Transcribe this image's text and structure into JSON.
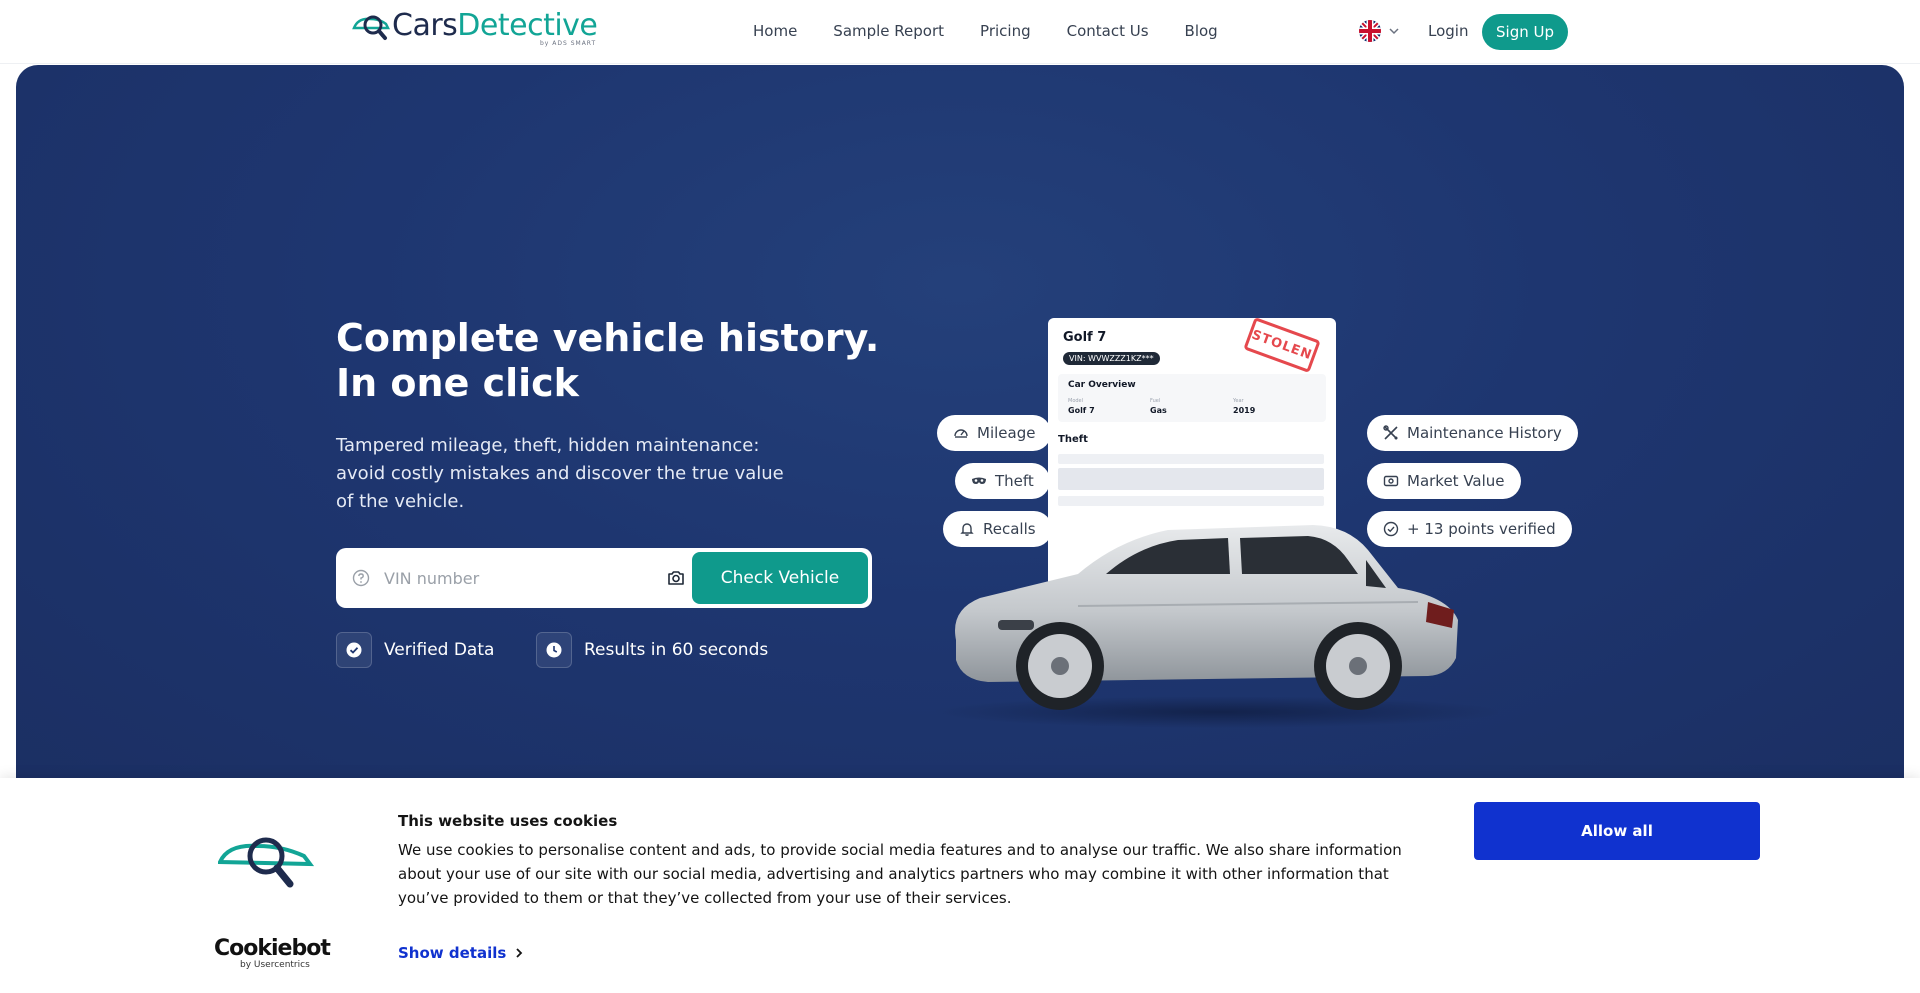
{
  "header": {
    "logo": {
      "part1": "Cars",
      "part2": "Detective",
      "sub": "by ADS SMART"
    },
    "nav": [
      "Home",
      "Sample Report",
      "Pricing",
      "Contact Us",
      "Blog"
    ],
    "login": "Login",
    "signup": "Sign Up",
    "language_icon": "uk-flag-icon"
  },
  "hero": {
    "headline_line1": "Complete vehicle history.",
    "headline_line2": "In one click",
    "subtext": "Tampered mileage, theft, hidden maintenance: avoid costly mistakes and discover the true value of the vehicle.",
    "search": {
      "placeholder": "VIN number",
      "button": "Check Vehicle"
    },
    "badges": [
      "Verified Data",
      "Results in 60 seconds"
    ],
    "features_left": [
      "Mileage",
      "Theft",
      "Recalls"
    ],
    "features_right": [
      "Maintenance History",
      "Market Value",
      "+ 13 points verified"
    ],
    "report": {
      "model": "Golf 7",
      "vin": "VIN: WVWZZZ1KZ***",
      "overview_title": "Car Overview",
      "overview_labels": [
        "Model",
        "Fuel",
        "Year"
      ],
      "overview_values": [
        "Golf 7",
        "Gas",
        "2019"
      ],
      "theft_title": "Theft",
      "stamp": "STOLEN"
    }
  },
  "cookie": {
    "title": "This website uses cookies",
    "text": "We use cookies to personalise content and ads, to provide social media features and to analyse our traffic. We also share information about your use of our site with our social media, advertising and analytics partners who may combine it with other information that you’ve provided to them or that they’ve collected from your use of their services.",
    "show_details": "Show details",
    "allow_all": "Allow all",
    "brand": "Cookiebot",
    "brand_sub": "by Usercentrics"
  },
  "colors": {
    "primary": "#0f9a8c",
    "hero": "#1e3670",
    "cookie_button": "#1032cf",
    "stamp": "#e5484d"
  }
}
